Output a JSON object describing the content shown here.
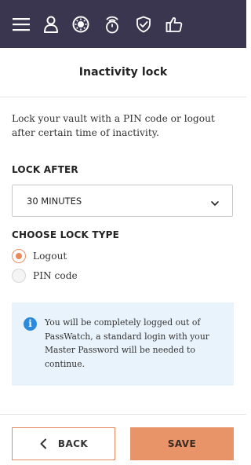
{
  "topbar": {
    "background": "#3b3650",
    "icons": [
      "menu-icon",
      "user-icon",
      "vault-dial-icon",
      "timer-lock-icon",
      "shield-check-icon",
      "thumbs-up-icon"
    ]
  },
  "header": {
    "title": "Inactivity lock"
  },
  "main": {
    "description": "Lock your vault with a PIN code or logout after certain time of inactivity.",
    "lock_after": {
      "label": "LOCK AFTER",
      "selected": "30 MINUTES"
    },
    "lock_type": {
      "label": "CHOOSE LOCK TYPE",
      "options": [
        {
          "label": "Logout",
          "checked": true
        },
        {
          "label": "PIN code",
          "checked": false
        }
      ]
    },
    "info": {
      "icon_glyph": "i",
      "text": "You will be completely logged out of PassWatch, a standard login with your Master Password will be needed to continue."
    }
  },
  "footer": {
    "back_label": "BACK",
    "save_label": "SAVE"
  },
  "colors": {
    "accent": "#e99468",
    "info_bg": "#e9f3fb",
    "info_icon": "#2b8ad9"
  }
}
